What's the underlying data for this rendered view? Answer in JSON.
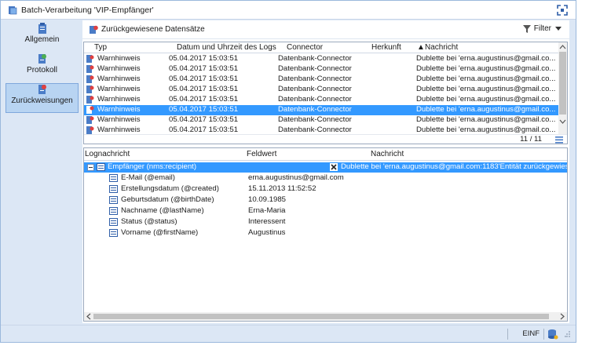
{
  "window": {
    "title": "Batch-Verarbeitung 'VIP-Empfänger'"
  },
  "sidebar": {
    "items": [
      {
        "label": "Allgemein",
        "icon": "clipboard-icon"
      },
      {
        "label": "Protokoll",
        "icon": "log-icon"
      },
      {
        "label": "Zurückweisungen",
        "icon": "rejection-icon",
        "active": true
      }
    ]
  },
  "toolbar": {
    "rejected_label": "Zurückgewiesene Datensätze",
    "filter_label": "Filter"
  },
  "grid": {
    "columns": [
      "Typ",
      "Datum und Uhrzeit des Logs",
      "Connector",
      "Herkunft",
      "Nachricht"
    ],
    "rows": [
      {
        "typ": "Warnhinweis",
        "datum": "05.04.2017 15:03:51",
        "connector": "Datenbank-Connector",
        "herkunft": "",
        "nachricht": "Dublette bei 'erna.augustinus@gmail.co..."
      },
      {
        "typ": "Warnhinweis",
        "datum": "05.04.2017 15:03:51",
        "connector": "Datenbank-Connector",
        "herkunft": "",
        "nachricht": "Dublette bei 'erna.augustinus@gmail.co..."
      },
      {
        "typ": "Warnhinweis",
        "datum": "05.04.2017 15:03:51",
        "connector": "Datenbank-Connector",
        "herkunft": "",
        "nachricht": "Dublette bei 'erna.augustinus@gmail.co..."
      },
      {
        "typ": "Warnhinweis",
        "datum": "05.04.2017 15:03:51",
        "connector": "Datenbank-Connector",
        "herkunft": "",
        "nachricht": "Dublette bei 'erna.augustinus@gmail.co..."
      },
      {
        "typ": "Warnhinweis",
        "datum": "05.04.2017 15:03:51",
        "connector": "Datenbank-Connector",
        "herkunft": "",
        "nachricht": "Dublette bei 'erna.augustinus@gmail.co..."
      },
      {
        "typ": "Warnhinweis",
        "datum": "05.04.2017 15:03:51",
        "connector": "Datenbank-Connector",
        "herkunft": "",
        "nachricht": "Dublette bei 'erna.augustinus@gmail.co...",
        "selected": true
      },
      {
        "typ": "Warnhinweis",
        "datum": "05.04.2017 15:03:51",
        "connector": "Datenbank-Connector",
        "herkunft": "",
        "nachricht": "Dublette bei 'erna.augustinus@gmail.co..."
      },
      {
        "typ": "Warnhinweis",
        "datum": "05.04.2017 15:03:51",
        "connector": "Datenbank-Connector",
        "herkunft": "",
        "nachricht": "Dublette bei 'erna.augustinus@gmail.co..."
      }
    ],
    "count": "11 / 11"
  },
  "detail": {
    "columns": [
      "Lognachricht",
      "Feldwert",
      "Nachricht"
    ],
    "root": {
      "label": "Empfänger (nms:recipient)",
      "message": "Dublette bei 'erna.augustinus@gmail.com:1183'Entität zurückgewies"
    },
    "fields": [
      {
        "label": "E-Mail (@email)",
        "value": "erna.augustinus@gmail.com"
      },
      {
        "label": "Erstellungsdatum (@created)",
        "value": "15.11.2013 11:52:52"
      },
      {
        "label": "Geburtsdatum (@birthDate)",
        "value": "10.09.1985"
      },
      {
        "label": "Nachname (@lastName)",
        "value": "Erna-Maria"
      },
      {
        "label": "Status (@status)",
        "value": "Interessent"
      },
      {
        "label": "Vorname (@firstName)",
        "value": "Augustinus"
      }
    ]
  },
  "statusbar": {
    "mode": "EINF"
  },
  "colors": {
    "accent": "#3399ff",
    "frame": "#dce7f5",
    "active_item": "#b8d4f2"
  }
}
